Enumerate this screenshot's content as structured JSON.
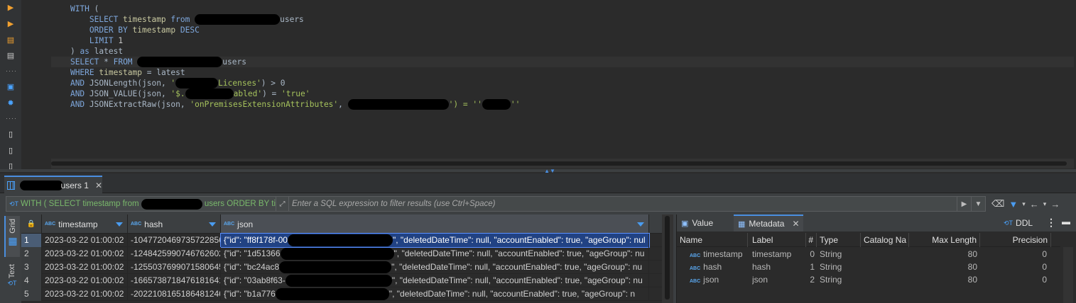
{
  "editor": {
    "lines": [
      {
        "indent": "    ",
        "parts": [
          {
            "t": "WITH",
            "c": "kw"
          },
          {
            "t": " (",
            "c": ""
          }
        ]
      },
      {
        "indent": "        ",
        "parts": [
          {
            "t": "SELECT",
            "c": "kw"
          },
          {
            "t": " timestamp ",
            "c": "idf"
          },
          {
            "t": "from",
            "c": "kw"
          },
          {
            "t": " ",
            "c": ""
          },
          {
            "redact": 120
          },
          {
            "t": "users",
            "c": ""
          }
        ]
      },
      {
        "indent": "        ",
        "parts": [
          {
            "t": "ORDER BY",
            "c": "kw"
          },
          {
            "t": " timestamp ",
            "c": "idf"
          },
          {
            "t": "DESC",
            "c": "kw"
          }
        ]
      },
      {
        "indent": "        ",
        "parts": [
          {
            "t": "LIMIT",
            "c": "kw"
          },
          {
            "t": " 1",
            "c": "num"
          }
        ]
      },
      {
        "indent": "    ",
        "parts": [
          {
            "t": ") ",
            "c": ""
          },
          {
            "t": "as",
            "c": "kw"
          },
          {
            "t": " latest",
            "c": ""
          }
        ]
      },
      {
        "indent": "    ",
        "parts": [
          {
            "t": "SELECT",
            "c": "kw"
          },
          {
            "t": " * ",
            "c": ""
          },
          {
            "t": "FROM",
            "c": "kw"
          },
          {
            "t": " ",
            "c": ""
          },
          {
            "redact": 120
          },
          {
            "t": "users",
            "c": ""
          }
        ]
      },
      {
        "indent": "    ",
        "parts": [
          {
            "t": "WHERE",
            "c": "kw"
          },
          {
            "t": " timestamp ",
            "c": "idf"
          },
          {
            "t": "= latest",
            "c": ""
          }
        ]
      },
      {
        "indent": "    ",
        "parts": [
          {
            "t": "AND",
            "c": "kw"
          },
          {
            "t": " JSONLength(json, ",
            "c": ""
          },
          {
            "t": "'",
            "c": "str"
          },
          {
            "redact": 60
          },
          {
            "t": "Licenses'",
            "c": "str"
          },
          {
            "t": ") > 0",
            "c": ""
          }
        ]
      },
      {
        "indent": "    ",
        "parts": [
          {
            "t": "AND",
            "c": "kw"
          },
          {
            "t": " JSON_VALUE(json, ",
            "c": ""
          },
          {
            "t": "'$.",
            "c": "str"
          },
          {
            "redact": 68
          },
          {
            "t": "abled'",
            "c": "str"
          },
          {
            "t": ") = ",
            "c": ""
          },
          {
            "t": "'true'",
            "c": "str"
          }
        ]
      },
      {
        "indent": "    ",
        "parts": [
          {
            "t": "AND",
            "c": "kw"
          },
          {
            "t": " JSONExtractRaw(json, ",
            "c": ""
          },
          {
            "t": "'onPremisesExtensionAttributes'",
            "c": "str"
          },
          {
            "t": ", ",
            "c": ""
          },
          {
            "redact": 142
          },
          {
            "t": "') = ",
            "c": "str"
          },
          {
            "t": "''",
            "c": "str"
          },
          {
            "redact": 40
          },
          {
            "t": "''",
            "c": "str"
          }
        ]
      }
    ]
  },
  "results": {
    "tab_label": "users 1",
    "filter_query": "WITH ( SELECT timestamp from",
    "filter_query_tail": "users ORDER BY ti",
    "filter_placeholder": "Enter a SQL expression to filter results (use Ctrl+Space)",
    "side_tabs": {
      "grid": "Grid",
      "text": "Text"
    },
    "columns": [
      "timestamp",
      "hash",
      "json"
    ],
    "rows": [
      {
        "num": "1",
        "timestamp": "2023-03-22 01:00:02",
        "hash": "-1047720469735722856",
        "json_pre": "{\"id\": \"ff8f178f-00",
        "json_post": "\", \"deletedDateTime\": null, \"accountEnabled\": true, \"ageGroup\": nul"
      },
      {
        "num": "2",
        "timestamp": "2023-03-22 01:00:02",
        "hash": "-1248425990746762602",
        "json_pre": "{\"id\": \"1d51366",
        "json_post": "\", \"deletedDateTime\": null, \"accountEnabled\": true, \"ageGroup\": nu"
      },
      {
        "num": "3",
        "timestamp": "2023-03-22 01:00:02",
        "hash": "-1255037699071580645",
        "json_pre": "{\"id\": \"bc24ac8",
        "json_post": "\", \"deletedDateTime\": null, \"accountEnabled\": true, \"ageGroup\": nu"
      },
      {
        "num": "4",
        "timestamp": "2023-03-22 01:00:02",
        "hash": "-1665738718476181641",
        "json_pre": "{\"id\": \"03ab8f63-",
        "json_post": "\", \"deletedDateTime\": null, \"accountEnabled\": true, \"ageGroup\": nu"
      },
      {
        "num": "5",
        "timestamp": "2023-03-22 01:00:02",
        "hash": "-2022108165186481246",
        "json_pre": "{\"id\": \"b1a776",
        "json_post": "\", \"deletedDateTime\": null, \"accountEnabled\": true, \"ageGroup\": n"
      }
    ]
  },
  "panel": {
    "tabs": {
      "value": "Value",
      "metadata": "Metadata"
    },
    "ddl": "DDL",
    "headers": {
      "name": "Name",
      "label": "Label",
      "num": "#",
      "type": "Type",
      "catalog": "Catalog Na",
      "max_length": "Max Length",
      "precision": "Precision"
    },
    "rows": [
      {
        "name": "timestamp",
        "label": "timestamp",
        "num": "0",
        "type": "String",
        "max_length": "80",
        "precision": "0"
      },
      {
        "name": "hash",
        "label": "hash",
        "num": "1",
        "type": "String",
        "max_length": "80",
        "precision": "0"
      },
      {
        "name": "json",
        "label": "json",
        "num": "2",
        "type": "String",
        "max_length": "80",
        "precision": "0"
      }
    ]
  },
  "colors": {
    "accent": "#4a8ee0",
    "keyword": "#7ea7dc",
    "string": "#a5c25c",
    "selection": "#214283"
  }
}
